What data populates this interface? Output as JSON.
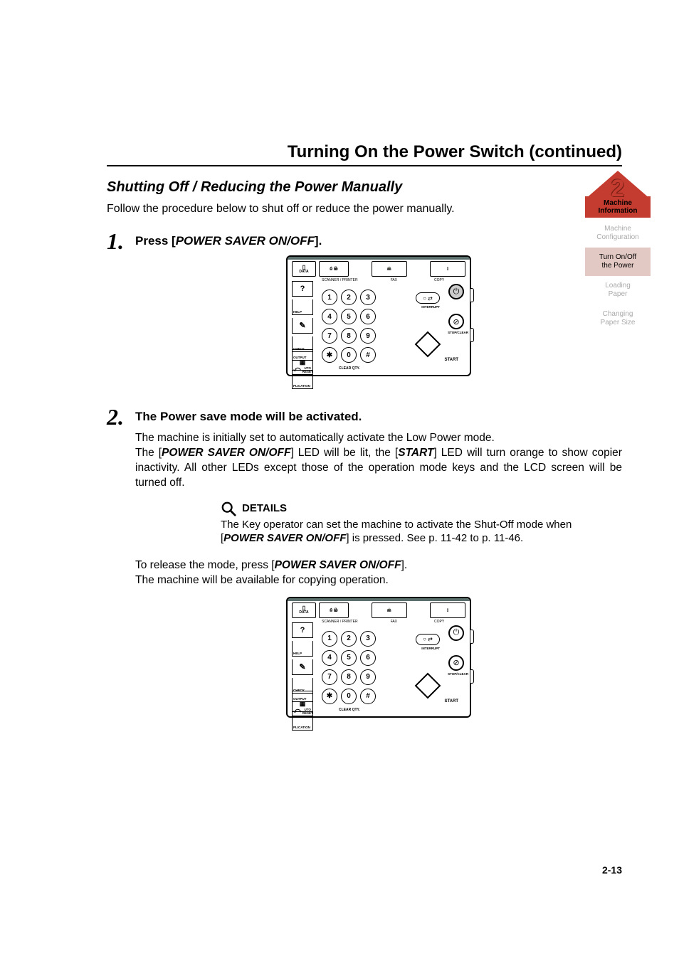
{
  "header": {
    "title": "Turning On the Power Switch (continued)"
  },
  "section": {
    "subtitle": "Shutting Off / Reducing the Power Manually",
    "intro": "Follow the procedure below to shut off or reduce the power manually."
  },
  "steps": {
    "one": {
      "n": "1.",
      "heading_pre": "Press [",
      "heading_key": "POWER SAVER ON/OFF",
      "heading_post": "]."
    },
    "two": {
      "n": "2.",
      "heading": "The Power save mode will be activated.",
      "body_1": "The machine is initially set to automatically activate the Low Power mode.",
      "body_2a": "The [",
      "body_2b": "POWER SAVER ON/OFF",
      "body_2c": "] LED will be lit, the [",
      "body_2d": "START",
      "body_2e": "] LED will turn orange to show copier inactivity. All other LEDs except those of the operation mode keys and the LCD screen will be turned off."
    }
  },
  "details": {
    "label": "DETAILS",
    "text_a": "The Key operator can set the machine to activate the Shut-Off mode when [",
    "text_b": "POWER SAVER ON/OFF",
    "text_c": "] is pressed. See p. 11-42 to p. 11-46."
  },
  "release": {
    "line1_a": "To release the mode, press [",
    "line1_b": "POWER SAVER ON/OFF",
    "line1_c": "].",
    "line2": "The machine will be available for copying operation."
  },
  "panel": {
    "data": "DATA",
    "scanner_printer": "SCANNER / PRINTER",
    "fax": "FAX",
    "copy": "COPY",
    "help": "HELP",
    "check": "CHECK",
    "plication": "PLICATION",
    "output": "OUTPUT",
    "uto_reset": "UTO RESET",
    "keys": [
      "1",
      "2",
      "3",
      "4",
      "5",
      "6",
      "7",
      "8",
      "9",
      "✱",
      "0",
      "#"
    ],
    "clear_qty": "CLEAR QTY.",
    "power_label": "POWER SAVER",
    "interrupt": "INTERRUPT",
    "stop_clear": "STOP/CLEAR",
    "start": "START"
  },
  "sidebar": {
    "chapter_num": "2",
    "chapter_label1": "Machine",
    "chapter_label2": "Information",
    "items": [
      {
        "label": "Machine\nConfiguration",
        "active": false
      },
      {
        "label": "Turn On/Off\nthe Power",
        "active": true
      },
      {
        "label": "Loading\nPaper",
        "active": false
      },
      {
        "label": "Changing\nPaper Size",
        "active": false
      }
    ]
  },
  "page_number": "2-13"
}
